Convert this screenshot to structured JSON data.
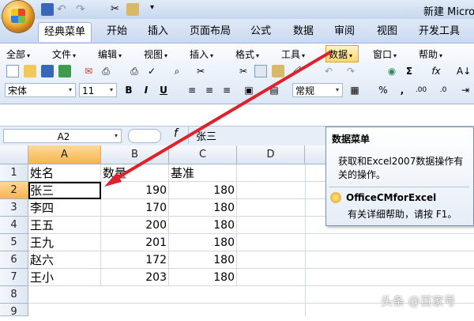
{
  "window": {
    "title": "新建 Micro"
  },
  "tabs": [
    "经典菜单",
    "开始",
    "插入",
    "页面布局",
    "公式",
    "数据",
    "审阅",
    "视图",
    "开发工具"
  ],
  "active_tab": "经典菜单",
  "menus": [
    "全部",
    "文件",
    "编辑",
    "视图",
    "插入",
    "格式",
    "工具",
    "数据",
    "窗口",
    "帮助"
  ],
  "highlighted_menu": "数据",
  "toolbar": {
    "font_name": "宋体",
    "font_size": "11",
    "number_format": "常规",
    "bold": "B",
    "italic": "I",
    "underline": "U",
    "percent": "%",
    "comma": ",",
    "sigma": "Σ",
    "fx": "fx"
  },
  "formula_bar": {
    "name_box": "A2",
    "fx_label": "f",
    "content": "张三"
  },
  "columns": [
    "A",
    "B",
    "C",
    "D"
  ],
  "rows": [
    "1",
    "2",
    "3",
    "4",
    "5",
    "6",
    "7",
    "8",
    "9"
  ],
  "sheet": [
    [
      "姓名",
      "数量",
      "基准"
    ],
    [
      "张三",
      "190",
      "180"
    ],
    [
      "李四",
      "170",
      "180"
    ],
    [
      "王五",
      "200",
      "180"
    ],
    [
      "王九",
      "201",
      "180"
    ],
    [
      "赵六",
      "172",
      "180"
    ],
    [
      "王小",
      "203",
      "180"
    ]
  ],
  "tooltip": {
    "title": "数据菜单",
    "description": "获取和Excel2007数据操作有关的操作。",
    "help_title": "OfficeCMforExcel",
    "help_text": "有关详细帮助，请按 F1。"
  },
  "watermark": "头条 @百家号",
  "colors": {
    "accent_arrow": "#e0202a",
    "selected_header": "#f7b44f",
    "ribbon": "#dce7f5"
  }
}
